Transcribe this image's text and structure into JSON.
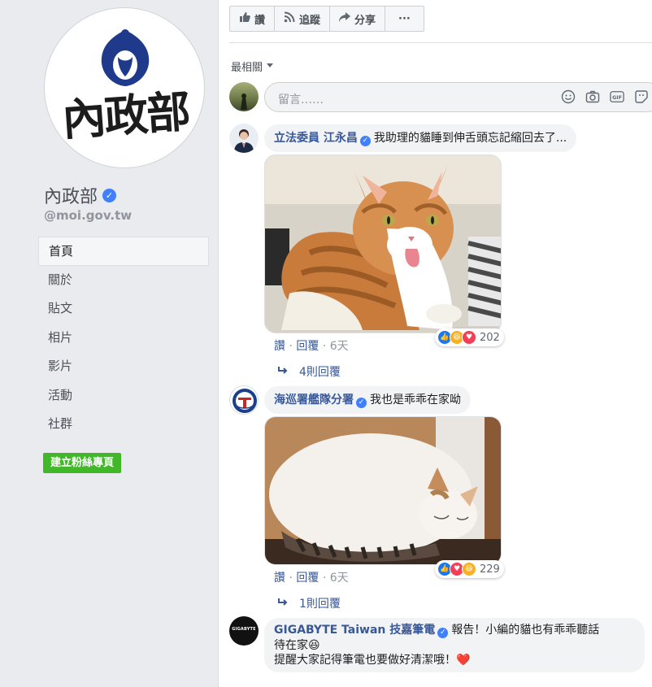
{
  "sidebar": {
    "logo_text": "內政部",
    "page_name": "內政部",
    "page_handle": "@moi.gov.tw",
    "nav": [
      {
        "label": "首頁",
        "active": true
      },
      {
        "label": "關於"
      },
      {
        "label": "貼文"
      },
      {
        "label": "相片"
      },
      {
        "label": "影片"
      },
      {
        "label": "活動"
      },
      {
        "label": "社群"
      }
    ],
    "create_page_button": "建立粉絲專頁"
  },
  "actions": {
    "like": "讚",
    "follow": "追蹤",
    "share": "分享",
    "more": "···"
  },
  "comments_section": {
    "sort_label": "最相關",
    "input_placeholder": "留言……"
  },
  "comments": [
    {
      "author": "立法委員 江永昌",
      "text": "我助理的貓睡到伸舌頭忘記縮回去了...",
      "meta": {
        "like": "讚",
        "reply": "回覆",
        "time": "6天"
      },
      "reaction_count": "202",
      "replies_label": "4則回覆"
    },
    {
      "author": "海巡署艦隊分署",
      "text": "我也是乖乖在家呦",
      "meta": {
        "like": "讚",
        "reply": "回覆",
        "time": "6天"
      },
      "reaction_count": "229",
      "replies_label": "1則回覆"
    },
    {
      "author": "GIGABYTE Taiwan 技嘉筆電",
      "text_line1": "報告！小編的貓也有乖乖聽話",
      "text_line2": "待在家😆",
      "text_line3": "提醒大家記得筆電也要做好清潔哦！❤️",
      "avatar_text": "GIGABYTE"
    }
  ],
  "colors": {
    "link": "#385898",
    "verified": "#4080ff",
    "create_button": "#42b72a",
    "like_reaction": "#1877f2",
    "love_reaction": "#f33e58",
    "haha_reaction": "#f7b125"
  }
}
